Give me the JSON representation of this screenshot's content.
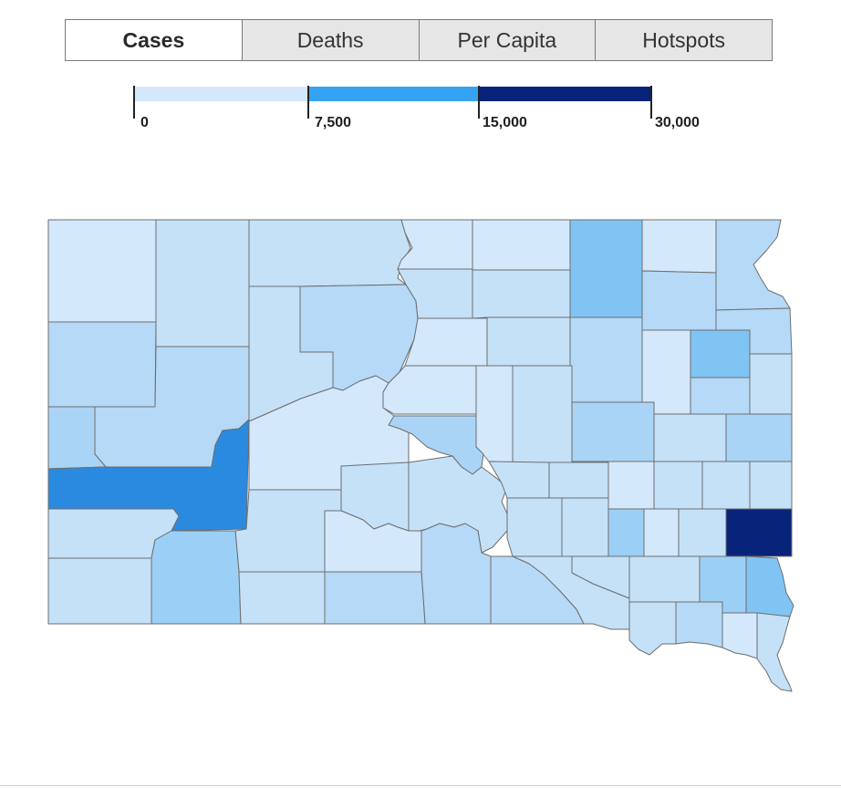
{
  "tabs": [
    {
      "label": "Cases",
      "active": true
    },
    {
      "label": "Deaths",
      "active": false
    },
    {
      "label": "Per Capita",
      "active": false
    },
    {
      "label": "Hotspots",
      "active": false
    }
  ],
  "legend": {
    "bins": [
      {
        "from": "0",
        "to": "7,500",
        "color": "#d3e8fb"
      },
      {
        "from": "7,500",
        "to": "15,000",
        "color": "#35a3f2"
      },
      {
        "from": "15,000",
        "to": "30,000",
        "color": "#08237a"
      }
    ],
    "labels": [
      "0",
      "7,500",
      "15,000",
      "30,000"
    ]
  },
  "colors": {
    "border": "#6e6e6e",
    "tab_background": "#e6e6e6",
    "tab_active_background": "#ffffff",
    "shade_1": "#d3e8fb",
    "shade_2": "#c4e1f8",
    "shade_3": "#b5d9f7",
    "shade_4": "#a9d4f6",
    "shade_5": "#9ccff5",
    "shade_6": "#80c4f4",
    "shade_7": "#2a8ae0",
    "shade_8": "#08237a"
  }
}
